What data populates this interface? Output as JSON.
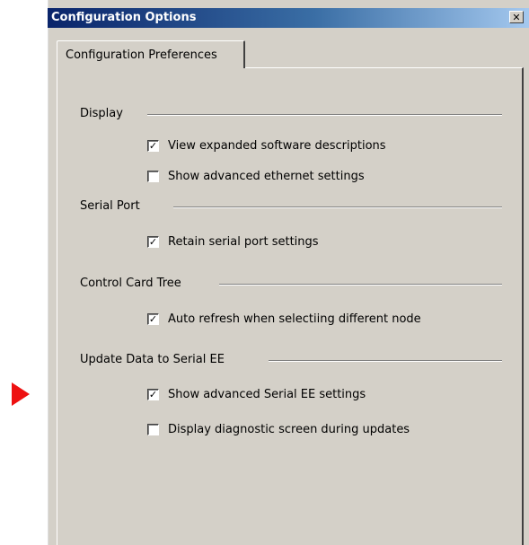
{
  "dialog": {
    "title": "Configuration Options",
    "close_glyph": "✕"
  },
  "tabs": [
    {
      "label": "Configuration Preferences",
      "active": true
    }
  ],
  "groups": [
    {
      "label": "Display",
      "options": [
        {
          "label": "View expanded software descriptions",
          "checked": true
        },
        {
          "label": "Show advanced ethernet settings",
          "checked": false
        }
      ]
    },
    {
      "label": "Serial Port",
      "options": [
        {
          "label": "Retain serial port settings",
          "checked": true
        }
      ]
    },
    {
      "label": "Control Card Tree",
      "options": [
        {
          "label": "Auto refresh when selectiing different node",
          "checked": true
        }
      ]
    },
    {
      "label": "Update Data to Serial EE",
      "options": [
        {
          "label": "Show advanced Serial EE settings",
          "checked": true
        },
        {
          "label": "Display diagnostic screen during updates",
          "checked": false
        }
      ]
    }
  ],
  "check_glyph": "✓",
  "colors": {
    "title_gradient_start": "#0a246a",
    "title_gradient_end": "#a6caf0",
    "dialog_face": "#d4d0c8",
    "pointer_marker": "#ee1111"
  },
  "icons": {
    "close": "close-icon",
    "pointer": "pointer-arrow-icon"
  }
}
